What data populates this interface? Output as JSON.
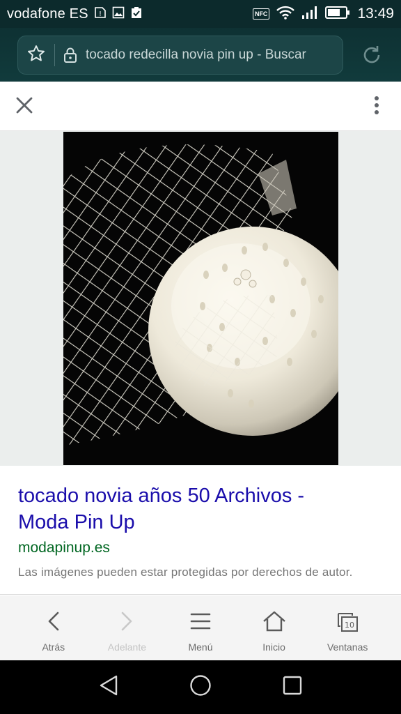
{
  "status_bar": {
    "carrier": "vodafone ES",
    "nfc_label": "NFC",
    "time": "13:49",
    "icons": [
      "no-sim-warning-icon",
      "image-notification-icon",
      "clipboard-check-icon",
      "nfc-icon",
      "wifi-icon",
      "signal-icon",
      "battery-icon"
    ]
  },
  "address_bar": {
    "url_text": "tocado redecilla novia pin up - Buscar",
    "icons": [
      "star-icon",
      "lock-icon",
      "reload-icon"
    ]
  },
  "viewer_toolbar": {
    "icons": [
      "close-icon",
      "more-vert-icon"
    ]
  },
  "result": {
    "title_line1": "tocado novia años 50 Archivos -",
    "title_line2": "Moda Pin Up",
    "domain": "modapinup.es",
    "copyright_note": "Las imágenes pueden estar protegidas por derechos de autor."
  },
  "browser_nav": {
    "items": [
      {
        "label": "Atrás",
        "icon": "back-arrow-icon"
      },
      {
        "label": "Adelante",
        "icon": "forward-arrow-icon"
      },
      {
        "label": "Menú",
        "icon": "menu-icon"
      },
      {
        "label": "Inicio",
        "icon": "home-icon"
      },
      {
        "label": "Ventanas",
        "icon": "windows-icon"
      }
    ],
    "windows_count": "10"
  },
  "system_nav": {
    "icons": [
      "back-triangle-icon",
      "home-circle-icon",
      "recents-square-icon"
    ]
  },
  "colors": {
    "status_bar": "#0c2a2c",
    "result_title": "#1a0dab",
    "result_domain": "#006621"
  }
}
